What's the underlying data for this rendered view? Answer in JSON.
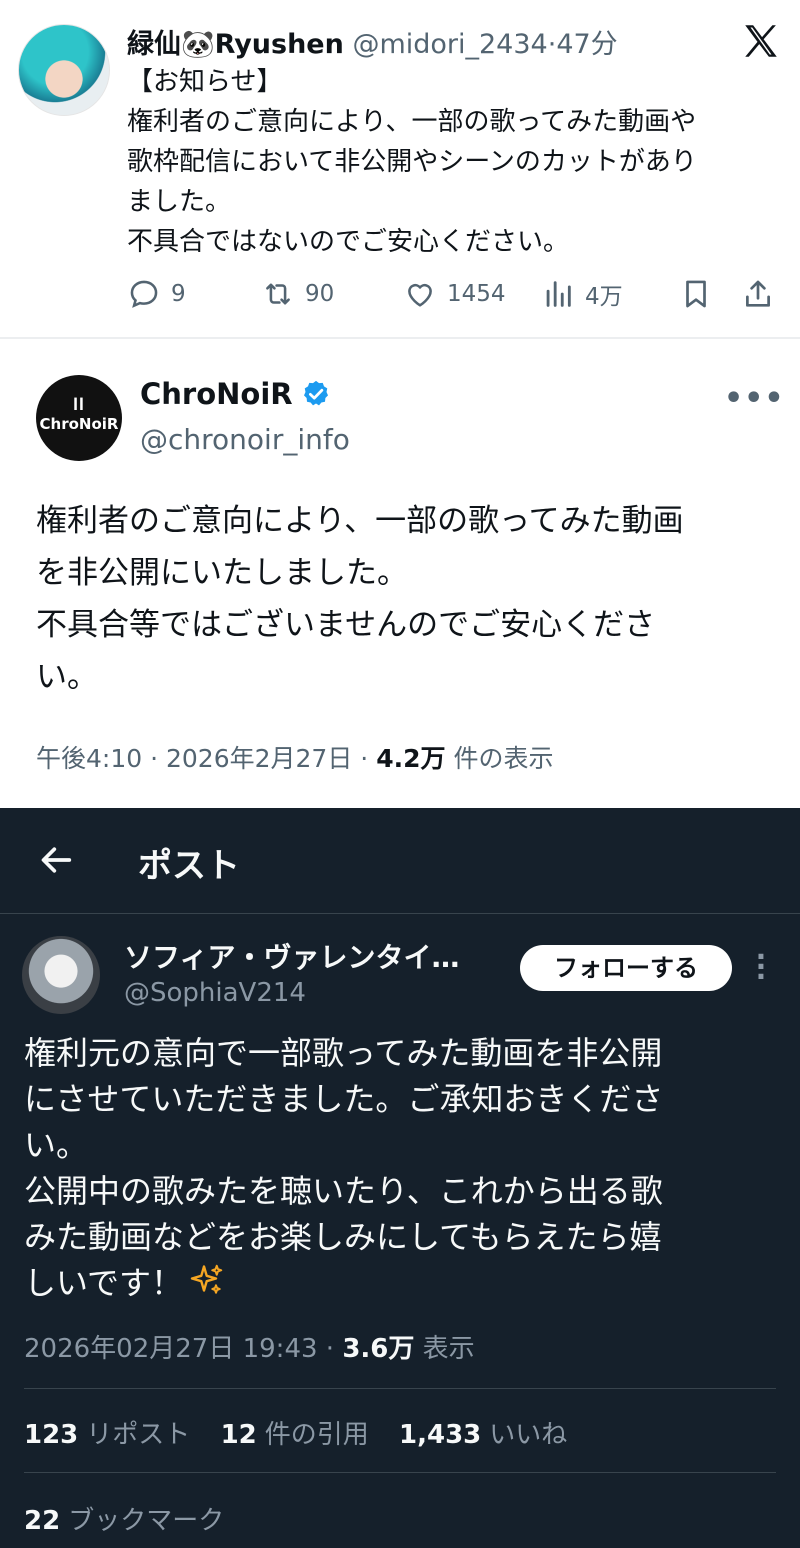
{
  "post1": {
    "display_name": "緑仙🐼Ryushen",
    "handle": "@midori_2434",
    "separator": "·",
    "time": "47分",
    "body_lines": [
      "【お知らせ】",
      "権利者のご意向により、一部の歌ってみた動画や",
      "歌枠配信において非公開やシーンのカットがあり",
      "ました。",
      "不具合ではないのでご安心ください。"
    ],
    "actions": {
      "replies": "9",
      "reposts": "90",
      "likes": "1454",
      "views": "4万"
    },
    "icons": [
      "reply-icon",
      "repost-icon",
      "like-icon",
      "views-icon",
      "bookmark-icon",
      "share-icon",
      "x-logo-icon"
    ]
  },
  "post2": {
    "logo_text": "ChroNoiR",
    "display_name": "ChroNoiR",
    "handle": "@chronoir_info",
    "body_lines": [
      "権利者のご意向により、一部の歌ってみた動画",
      "を非公開にいたしました。",
      "不具合等ではございませんのでご安心くださ",
      "い。"
    ],
    "meta": {
      "time": "午後4:10",
      "sep1": "·",
      "date": "2026年2月27日",
      "sep2": "·",
      "views": "4.2万",
      "views_label": "件の表示"
    },
    "colors": {
      "verified": "#1d9bf0"
    }
  },
  "post3": {
    "header_title": "ポスト",
    "display_name": "ソフィア・ヴァレンタイ…",
    "handle": "@SophiaV214",
    "follow_label": "フォローする",
    "body_lines": [
      "権利元の意向で一部歌ってみた動画を非公開",
      "にさせていただきました。ご承知おきくださ",
      "い。",
      "公開中の歌みたを聴いたり、これから出る歌",
      "みた動画などをお楽しみにしてもらえたら嬉",
      "しいです！"
    ],
    "meta": {
      "datetime": "2026年02月27日 19:43",
      "sep": "·",
      "views": "3.6万",
      "views_label": "表示"
    },
    "stats": {
      "reposts": "123",
      "reposts_label": "リポスト",
      "quotes": "12",
      "quotes_label": "件の引用",
      "likes": "1,433",
      "likes_label": "いいね",
      "bookmarks": "22",
      "bookmarks_label": "ブックマーク"
    },
    "colors": {
      "background": "#15202b",
      "sparkle": "#f5a623"
    }
  }
}
